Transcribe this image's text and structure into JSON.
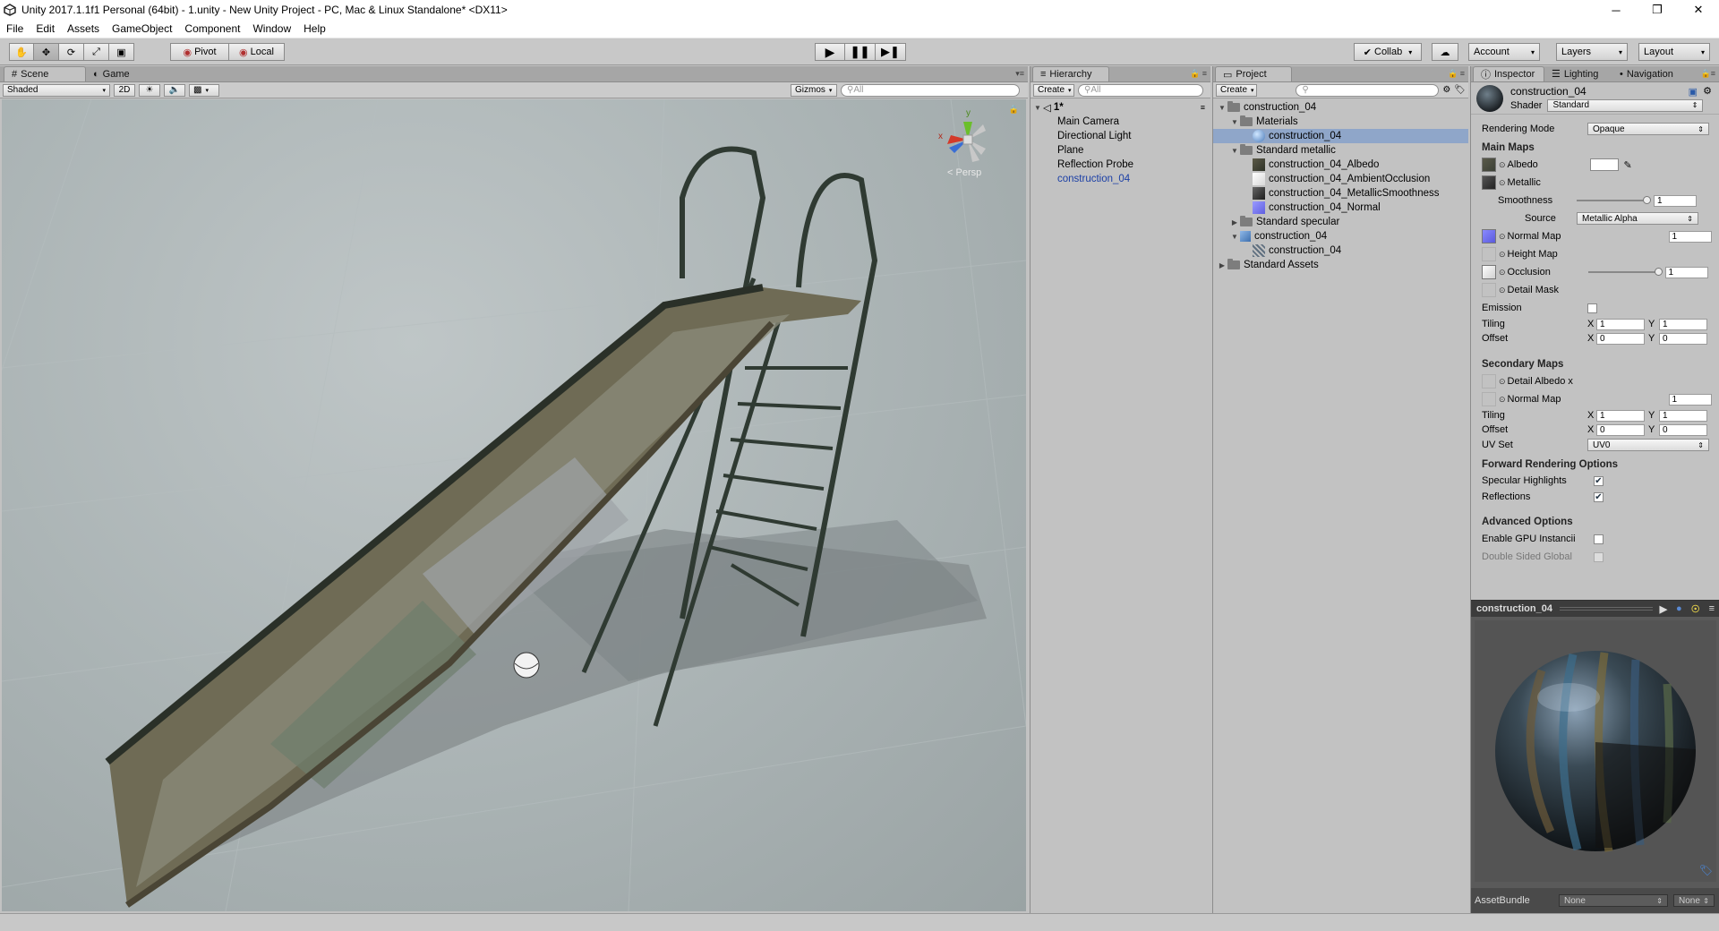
{
  "window": {
    "title": "Unity 2017.1.1f1 Personal (64bit) - 1.unity - New Unity Project - PC, Mac & Linux Standalone* <DX11>"
  },
  "menu": [
    "File",
    "Edit",
    "Assets",
    "GameObject",
    "Component",
    "Window",
    "Help"
  ],
  "toolbar": {
    "pivot": "Pivot",
    "local": "Local",
    "collab": "Collab",
    "account": "Account",
    "layers": "Layers",
    "layout": "Layout"
  },
  "scene": {
    "tabs": [
      "Scene",
      "Game"
    ],
    "shading": "Shaded",
    "mode2d": "2D",
    "gizmos": "Gizmos",
    "search_placeholder": "All",
    "persp": "Persp",
    "axis_y": "y",
    "axis_x": "x"
  },
  "hierarchy": {
    "tab": "Hierarchy",
    "create": "Create",
    "search_placeholder": "All",
    "scene_name": "1*",
    "items": [
      "Main Camera",
      "Directional Light",
      "Plane",
      "Reflection Probe",
      "construction_04"
    ]
  },
  "project": {
    "tab": "Project",
    "create": "Create",
    "tree": [
      {
        "label": "construction_04",
        "depth": 0,
        "arrow": "open",
        "kind": "folder"
      },
      {
        "label": "Materials",
        "depth": 1,
        "arrow": "open",
        "kind": "folder"
      },
      {
        "label": "construction_04",
        "depth": 2,
        "arrow": "",
        "kind": "material",
        "selected": true
      },
      {
        "label": "Standard metallic",
        "depth": 1,
        "arrow": "open",
        "kind": "folder"
      },
      {
        "label": "construction_04_Albedo",
        "depth": 2,
        "arrow": "",
        "kind": "tex-albedo"
      },
      {
        "label": "construction_04_AmbientOcclusion",
        "depth": 2,
        "arrow": "",
        "kind": "tex-ao"
      },
      {
        "label": "construction_04_MetallicSmoothness",
        "depth": 2,
        "arrow": "",
        "kind": "tex-metal"
      },
      {
        "label": "construction_04_Normal",
        "depth": 2,
        "arrow": "",
        "kind": "tex-normal"
      },
      {
        "label": "Standard specular",
        "depth": 1,
        "arrow": "closed",
        "kind": "folder"
      },
      {
        "label": "construction_04",
        "depth": 1,
        "arrow": "open",
        "kind": "prefab"
      },
      {
        "label": "construction_04",
        "depth": 2,
        "arrow": "",
        "kind": "mesh"
      },
      {
        "label": "Standard Assets",
        "depth": 0,
        "arrow": "closed",
        "kind": "folder"
      }
    ]
  },
  "inspector": {
    "tabs": [
      "Inspector",
      "Lighting",
      "Navigation"
    ],
    "object_name": "construction_04",
    "shader_label": "Shader",
    "shader_value": "Standard",
    "rendering_mode_label": "Rendering Mode",
    "rendering_mode": "Opaque",
    "main_maps": "Main Maps",
    "albedo": "Albedo",
    "metallic": "Metallic",
    "smoothness": "Smoothness",
    "smoothness_value": "1",
    "source_label": "Source",
    "source_value": "Metallic Alpha",
    "normal_map": "Normal Map",
    "normal_value": "1",
    "height_map": "Height Map",
    "occlusion": "Occlusion",
    "occlusion_value": "1",
    "detail_mask": "Detail Mask",
    "emission": "Emission",
    "tiling": "Tiling",
    "offset": "Offset",
    "x": "X",
    "y": "Y",
    "main_tiling_x": "1",
    "main_tiling_y": "1",
    "main_offset_x": "0",
    "main_offset_y": "0",
    "secondary_maps": "Secondary Maps",
    "detail_albedo": "Detail Albedo x",
    "sec_normal_map": "Normal Map",
    "sec_normal_value": "1",
    "sec_tiling_x": "1",
    "sec_tiling_y": "1",
    "sec_offset_x": "0",
    "sec_offset_y": "0",
    "uv_set_label": "UV Set",
    "uv_set": "UV0",
    "forward": "Forward Rendering Options",
    "specular": "Specular Highlights",
    "reflections": "Reflections",
    "advanced": "Advanced Options",
    "gpu_instancing": "Enable GPU Instancii",
    "double_sided": "Double Sided Global",
    "preview_title": "construction_04",
    "assetbundle_label": "AssetBundle",
    "assetbundle_value": "None",
    "variant_value": "None"
  },
  "colors": {
    "panel": "#c2c2c2",
    "selection": "#8fa6c9",
    "scene_bg": "#aeb7b8",
    "hierarchy_link": "#1b3fa6"
  }
}
